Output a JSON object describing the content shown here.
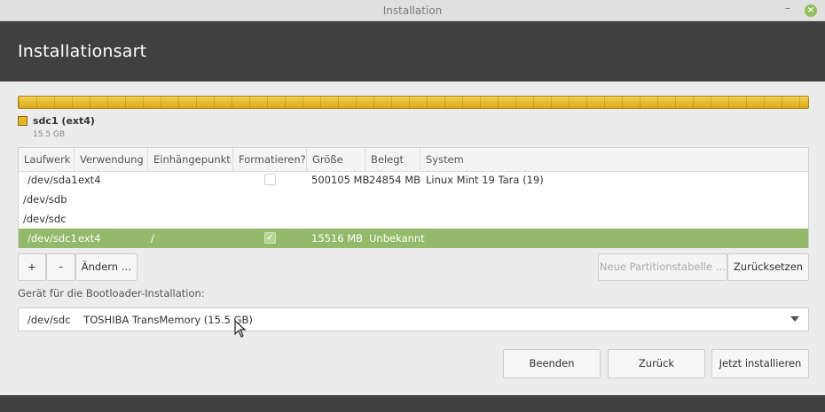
{
  "window": {
    "title": "Installation",
    "minimize": "–",
    "close": "×"
  },
  "header": {
    "title": "Installationsart"
  },
  "partition_bar": {
    "color": "#e7b523"
  },
  "legend": {
    "label": "sdc1 (ext4)",
    "size": "15.5 GB",
    "color": "#e7b523"
  },
  "table": {
    "columns": [
      "Laufwerk",
      "Verwendung",
      "Einhängepunkt",
      "Formatieren?",
      "Größe",
      "Belegt",
      "System"
    ],
    "rows": [
      {
        "device": "/dev/sda1",
        "usage": "ext4",
        "mount": "",
        "format": false,
        "size": "500105 MB",
        "used": "24854 MB",
        "system": "Linux Mint 19 Tara (19)"
      },
      {
        "device": "/dev/sdb"
      },
      {
        "device": "/dev/sdc"
      },
      {
        "device": "/dev/sdc1",
        "usage": "ext4",
        "mount": "/",
        "format": true,
        "size": "15516 MB",
        "used": "Unbekannt",
        "system": ""
      }
    ],
    "selected_color": "#93b96a"
  },
  "buttons": {
    "add": "+",
    "remove": "–",
    "change": "Ändern …",
    "new_table": "Neue Partitionstabelle …",
    "revert": "Zurücksetzen",
    "quit": "Beenden",
    "back": "Zurück",
    "install": "Jetzt installieren"
  },
  "bootloader": {
    "label": "Gerät für die Bootloader-Installation:",
    "selected": "/dev/sdc    TOSHIBA TransMemory (15.5 GB)"
  },
  "icons": {
    "minimize": "minimize-icon",
    "close": "close-icon",
    "dropdown": "chevron-down-icon",
    "cursor": "mouse-pointer-icon"
  }
}
